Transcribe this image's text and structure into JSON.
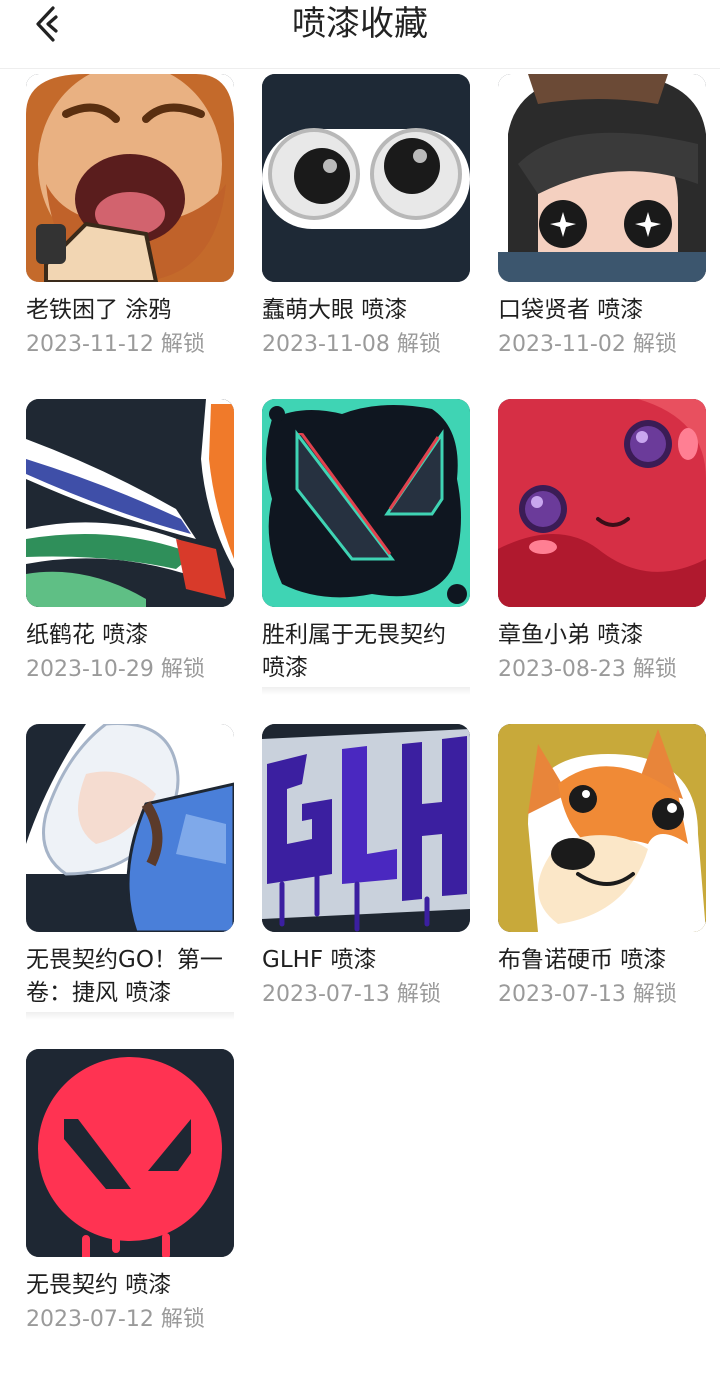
{
  "header": {
    "title": "喷漆收藏",
    "back_icon": "back-arrow-icon"
  },
  "items": [
    {
      "name": "老铁困了 涂鸦",
      "date": "2023-11-12 解锁",
      "icon": "yawning-bearded-man-icon"
    },
    {
      "name": "蠢萌大眼 喷漆",
      "date": "2023-11-08 解锁",
      "icon": "googly-eyes-icon"
    },
    {
      "name": "口袋贤者 喷漆",
      "date": "2023-11-02 解锁",
      "icon": "masked-agent-icon"
    },
    {
      "name": "纸鹤花 喷漆",
      "date": "2023-10-29 解锁",
      "icon": "bird-of-paradise-icon"
    },
    {
      "name": "胜利属于无畏契约 喷漆",
      "date": "",
      "icon": "valorant-logo-splatter-icon"
    },
    {
      "name": "章鱼小弟 喷漆",
      "date": "2023-08-23 解锁",
      "icon": "red-octopus-icon"
    },
    {
      "name": "无畏契约GO！第一卷：捷风 喷漆",
      "date": "",
      "icon": "jett-agent-icon"
    },
    {
      "name": "GLHF 喷漆",
      "date": "2023-07-13 解锁",
      "icon": "glhf-graffiti-icon"
    },
    {
      "name": "布鲁诺硬币 喷漆",
      "date": "2023-07-13 解锁",
      "icon": "corgi-coin-icon"
    },
    {
      "name": "无畏契约 喷漆",
      "date": "2023-07-12 解锁",
      "icon": "valorant-red-logo-icon"
    }
  ]
}
